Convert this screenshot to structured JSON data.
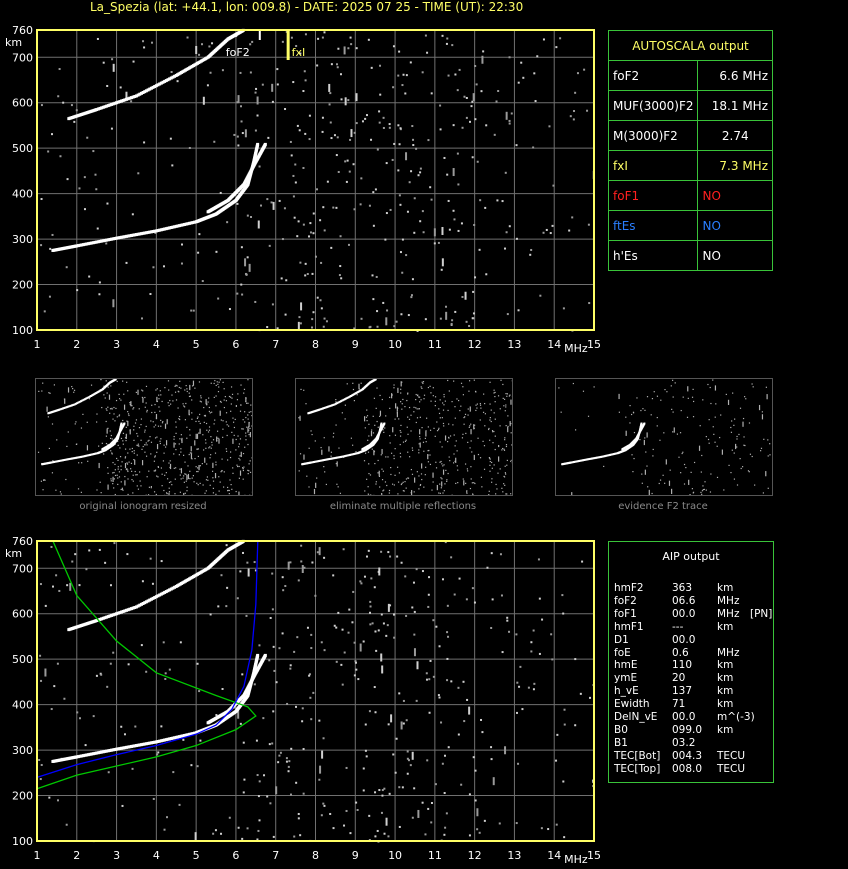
{
  "header": {
    "title": "La_Spezia (lat: +44.1, lon: 009.8) - DATE: 2025 07 25 - TIME (UT): 22:30"
  },
  "colors": {
    "axis": "#ffff66",
    "grid": "#707070",
    "trace": "#ffffff",
    "box_border": "#39c339",
    "foF1_label": "#ff2020",
    "ftEs_label": "#2a7fff",
    "fxI_label": "#ffff66",
    "aip_green_curve": "#00c800",
    "aip_blue_curve": "#0000ff"
  },
  "ionogram_top": {
    "marker_foF2": "foF2",
    "marker_fxI": "fxI",
    "unit_km": "km",
    "unit_mhz": "MHz"
  },
  "ionogram_bottom": {
    "unit_km": "km",
    "unit_mhz": "MHz"
  },
  "autoscala": {
    "title": "AUTOSCALA output",
    "rows": [
      {
        "label": "foF2",
        "value": "6.6 MHz"
      },
      {
        "label": "MUF(3000)F2",
        "value": "18.1 MHz"
      },
      {
        "label": "M(3000)F2",
        "value": "2.74"
      },
      {
        "label": "fxI",
        "value": "7.3 MHz"
      },
      {
        "label": "foF1",
        "value": "NO"
      },
      {
        "label": "ftEs",
        "value": "NO"
      },
      {
        "label": "h'Es",
        "value": "NO"
      }
    ]
  },
  "thumbnails": {
    "captions": [
      "original ionogram resized",
      "eliminate multiple reflections",
      "evidence F2 trace"
    ]
  },
  "aip": {
    "title": "AIP output",
    "rows": [
      {
        "name": "hmF2",
        "value": "363",
        "unit": "km",
        "extra": ""
      },
      {
        "name": "foF2",
        "value": "06.6",
        "unit": "MHz",
        "extra": ""
      },
      {
        "name": "foF1",
        "value": "00.0",
        "unit": "MHz",
        "extra": "[PN]"
      },
      {
        "name": "hmF1",
        "value": "---",
        "unit": "km",
        "extra": ""
      },
      {
        "name": "D1",
        "value": "00.0",
        "unit": "",
        "extra": ""
      },
      {
        "name": "foE",
        "value": "0.6",
        "unit": "MHz",
        "extra": ""
      },
      {
        "name": "hmE",
        "value": "110",
        "unit": "km",
        "extra": ""
      },
      {
        "name": "ymE",
        "value": "20",
        "unit": "km",
        "extra": ""
      },
      {
        "name": "h_vE",
        "value": "137",
        "unit": "km",
        "extra": ""
      },
      {
        "name": "Ewidth",
        "value": "71",
        "unit": "km",
        "extra": ""
      },
      {
        "name": "DelN_vE",
        "value": "00.0",
        "unit": "m^(-3)",
        "extra": ""
      },
      {
        "name": "B0",
        "value": "099.0",
        "unit": "km",
        "extra": ""
      },
      {
        "name": "B1",
        "value": "03.2",
        "unit": "",
        "extra": ""
      },
      {
        "name": "TEC[Bot]",
        "value": "004.3",
        "unit": "TECU",
        "extra": ""
      },
      {
        "name": "TEC[Top]",
        "value": "008.0",
        "unit": "TECU",
        "extra": ""
      }
    ]
  },
  "chart_data": [
    {
      "type": "scatter",
      "title": "",
      "xlabel": "MHz",
      "ylabel": "km",
      "xlim": [
        1,
        15
      ],
      "ylim": [
        100,
        760
      ],
      "x_ticks": [
        "1",
        "2",
        "3",
        "4",
        "5",
        "6",
        "7",
        "8",
        "9",
        "10",
        "11",
        "12",
        "13",
        "14",
        "15"
      ],
      "y_ticks": [
        "100",
        "200",
        "300",
        "400",
        "500",
        "600",
        "700",
        "760"
      ],
      "grid": true,
      "series": [
        {
          "values": [
            [
              1.4,
              275
            ],
            [
              2,
              285
            ],
            [
              3,
              302
            ],
            [
              4,
              318
            ],
            [
              5,
              338
            ],
            [
              5.5,
              355
            ],
            [
              6,
              385
            ],
            [
              6.3,
              420
            ],
            [
              6.45,
              470
            ],
            [
              6.55,
              510
            ]
          ]
        },
        {
          "values": [
            [
              5.3,
              360
            ],
            [
              5.8,
              385
            ],
            [
              6.2,
              420
            ],
            [
              6.5,
              470
            ],
            [
              6.75,
              510
            ]
          ]
        },
        {
          "values": [
            [
              1.8,
              565
            ],
            [
              2.5,
              585
            ],
            [
              3.5,
              615
            ],
            [
              4.5,
              660
            ],
            [
              5.3,
              700
            ],
            [
              5.8,
              740
            ],
            [
              6.2,
              760
            ]
          ]
        }
      ],
      "markers": [
        {
          "label": "foF2",
          "x": 6.6
        },
        {
          "label": "fxI",
          "x": 7.3
        }
      ]
    },
    {
      "type": "line",
      "title": "",
      "xlabel": "MHz",
      "ylabel": "km",
      "xlim": [
        1,
        15
      ],
      "ylim": [
        100,
        760
      ],
      "x_ticks": [
        "1",
        "2",
        "3",
        "4",
        "5",
        "6",
        "7",
        "8",
        "9",
        "10",
        "11",
        "12",
        "13",
        "14",
        "15"
      ],
      "y_ticks": [
        "100",
        "200",
        "300",
        "400",
        "500",
        "600",
        "700",
        "760"
      ],
      "grid": true,
      "series": [
        {
          "values": [
            [
              1,
              215
            ],
            [
              2,
              245
            ],
            [
              3,
              265
            ],
            [
              4,
              285
            ],
            [
              5,
              310
            ],
            [
              6,
              345
            ],
            [
              6.5,
              375
            ],
            [
              6.3,
              395
            ],
            [
              5.5,
              420
            ],
            [
              4,
              470
            ],
            [
              3,
              540
            ],
            [
              2,
              640
            ],
            [
              1.4,
              760
            ]
          ]
        },
        {
          "values": [
            [
              1,
              240
            ],
            [
              2,
              268
            ],
            [
              3,
              290
            ],
            [
              4,
              310
            ],
            [
              5,
              335
            ],
            [
              5.5,
              355
            ],
            [
              5.9,
              390
            ],
            [
              6.2,
              440
            ],
            [
              6.4,
              520
            ],
            [
              6.5,
              620
            ],
            [
              6.55,
              760
            ]
          ]
        }
      ]
    }
  ]
}
